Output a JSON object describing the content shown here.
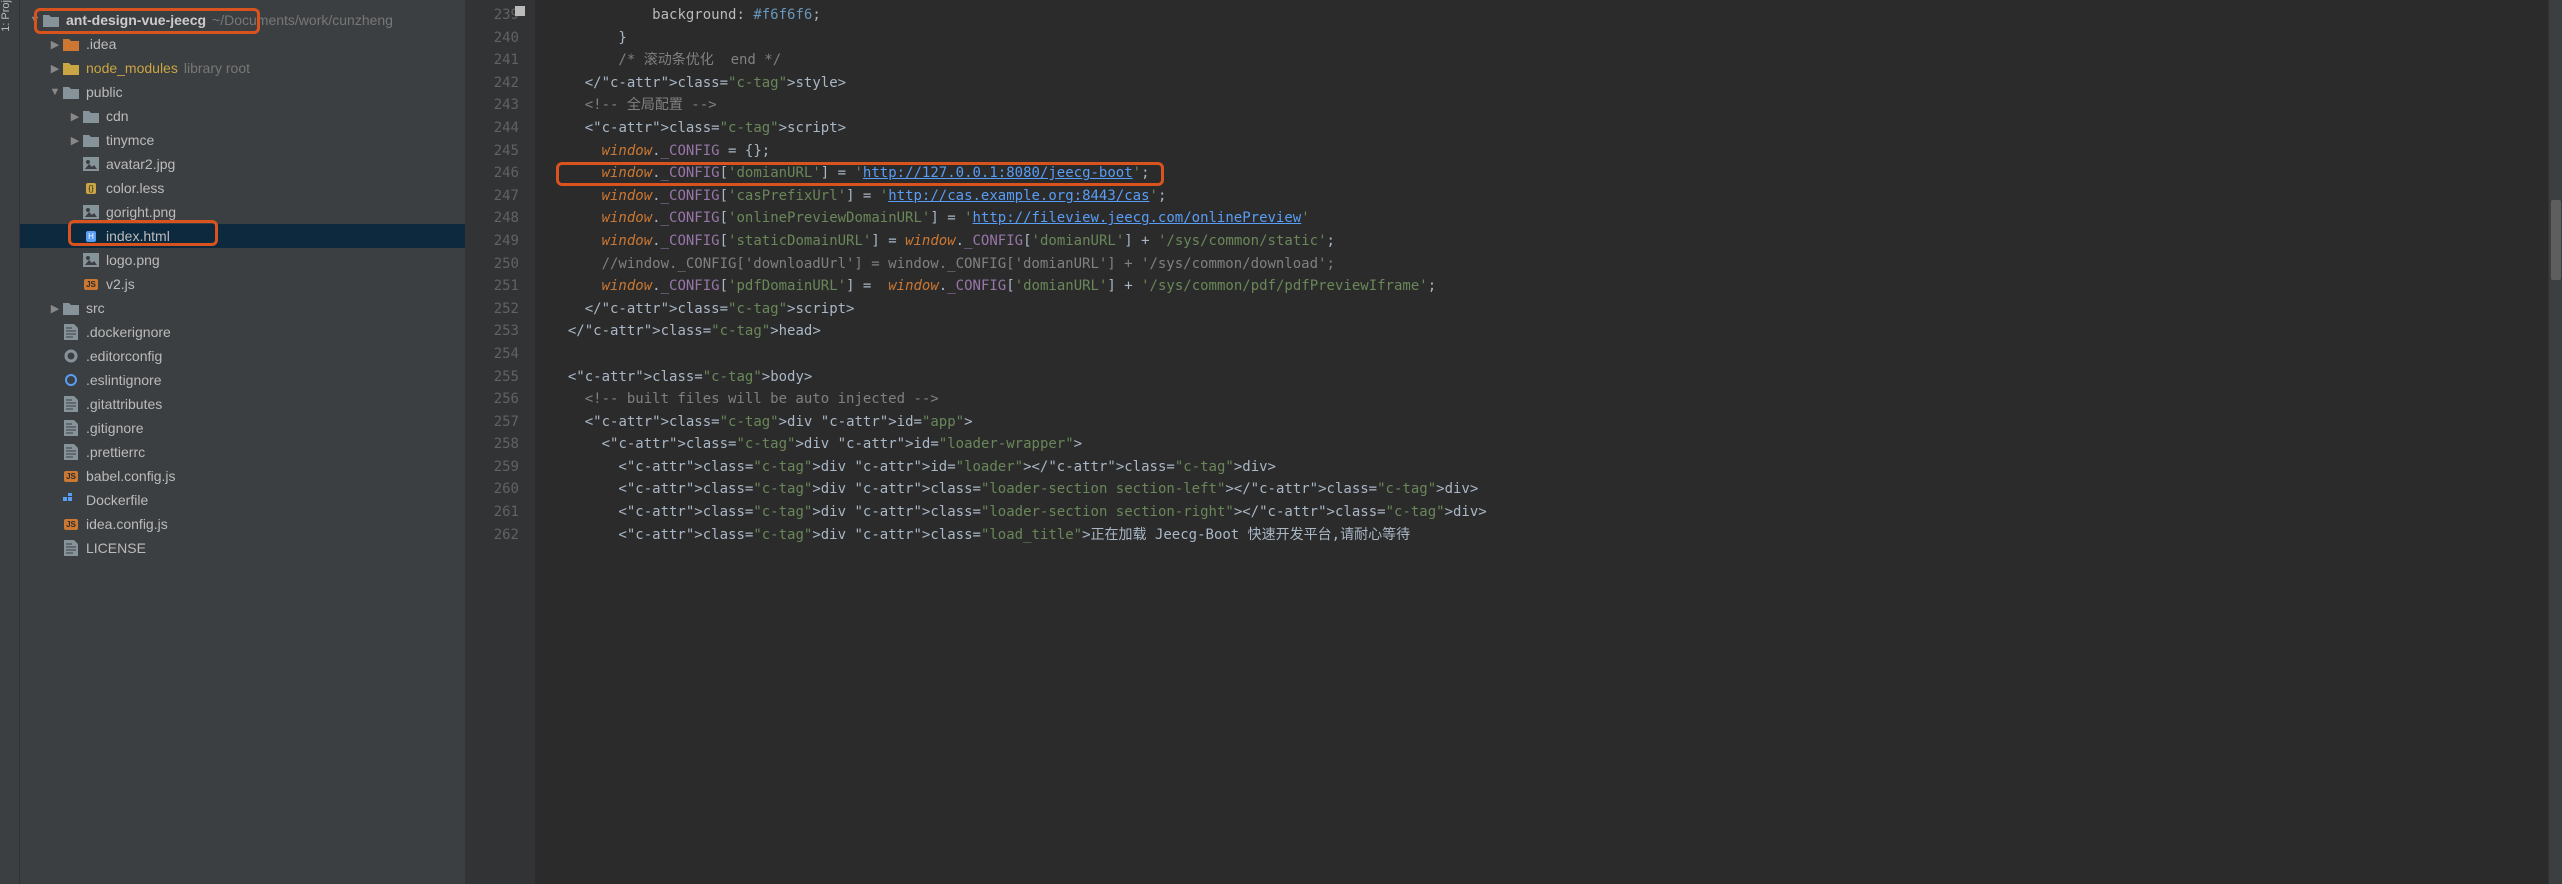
{
  "leftbar": {
    "label": "1: Proj"
  },
  "project": {
    "root": {
      "name": "ant-design-vue-jeecg",
      "path": "~/Documents/work/cunzheng"
    },
    "items": [
      {
        "label": ".idea",
        "indent": 1,
        "arrow": "right",
        "icon": "folder-orange"
      },
      {
        "label": "node_modules",
        "indent": 1,
        "arrow": "right",
        "icon": "folder-gold",
        "suffix": "library root",
        "gold": true
      },
      {
        "label": "public",
        "indent": 1,
        "arrow": "down",
        "icon": "folder"
      },
      {
        "label": "cdn",
        "indent": 2,
        "arrow": "right",
        "icon": "folder"
      },
      {
        "label": "tinymce",
        "indent": 2,
        "arrow": "right",
        "icon": "folder"
      },
      {
        "label": "avatar2.jpg",
        "indent": 2,
        "arrow": "none",
        "icon": "image"
      },
      {
        "label": "color.less",
        "indent": 2,
        "arrow": "none",
        "icon": "less"
      },
      {
        "label": "goright.png",
        "indent": 2,
        "arrow": "none",
        "icon": "image"
      },
      {
        "label": "index.html",
        "indent": 2,
        "arrow": "none",
        "icon": "html",
        "selected": true
      },
      {
        "label": "logo.png",
        "indent": 2,
        "arrow": "none",
        "icon": "image"
      },
      {
        "label": "v2.js",
        "indent": 2,
        "arrow": "none",
        "icon": "js"
      },
      {
        "label": "src",
        "indent": 1,
        "arrow": "right",
        "icon": "folder"
      },
      {
        "label": ".dockerignore",
        "indent": 1,
        "arrow": "none",
        "icon": "file"
      },
      {
        "label": ".editorconfig",
        "indent": 1,
        "arrow": "none",
        "icon": "gear"
      },
      {
        "label": ".eslintignore",
        "indent": 1,
        "arrow": "none",
        "icon": "circle"
      },
      {
        "label": ".gitattributes",
        "indent": 1,
        "arrow": "none",
        "icon": "file"
      },
      {
        "label": ".gitignore",
        "indent": 1,
        "arrow": "none",
        "icon": "file"
      },
      {
        "label": ".prettierrc",
        "indent": 1,
        "arrow": "none",
        "icon": "file"
      },
      {
        "label": "babel.config.js",
        "indent": 1,
        "arrow": "none",
        "icon": "js"
      },
      {
        "label": "Dockerfile",
        "indent": 1,
        "arrow": "none",
        "icon": "docker"
      },
      {
        "label": "idea.config.js",
        "indent": 1,
        "arrow": "none",
        "icon": "js"
      },
      {
        "label": "LICENSE",
        "indent": 1,
        "arrow": "none",
        "icon": "file"
      }
    ]
  },
  "editor": {
    "startLine": 239,
    "lines": [
      "            background: #f6f6f6;",
      "        }",
      "        /* 滚动条优化  end */",
      "    </style>",
      "    <!-- 全局配置 -->",
      "    <script>",
      "      window._CONFIG = {};",
      "      window._CONFIG['domianURL'] = 'http://127.0.0.1:8080/jeecg-boot';",
      "      window._CONFIG['casPrefixUrl'] = 'http://cas.example.org:8443/cas';",
      "      window._CONFIG['onlinePreviewDomainURL'] = 'http://fileview.jeecg.com/onlinePreview'",
      "      window._CONFIG['staticDomainURL'] = window._CONFIG['domianURL'] + '/sys/common/static';",
      "      //window._CONFIG['downloadUrl'] = window._CONFIG['domianURL'] + '/sys/common/download';",
      "      window._CONFIG['pdfDomainURL'] =  window._CONFIG['domianURL'] + '/sys/common/pdf/pdfPreviewIframe';",
      "    </script>",
      "  </head>",
      "",
      "  <body>",
      "    <!-- built files will be auto injected -->",
      "    <div id=\"app\">",
      "      <div id=\"loader-wrapper\">",
      "        <div id=\"loader\"></div>",
      "        <div class=\"loader-section section-left\"></div>",
      "        <div class=\"loader-section section-right\"></div>",
      "        <div class=\"load_title\">正在加载 Jeecg-Boot 快速开发平台,请耐心等待"
    ]
  }
}
